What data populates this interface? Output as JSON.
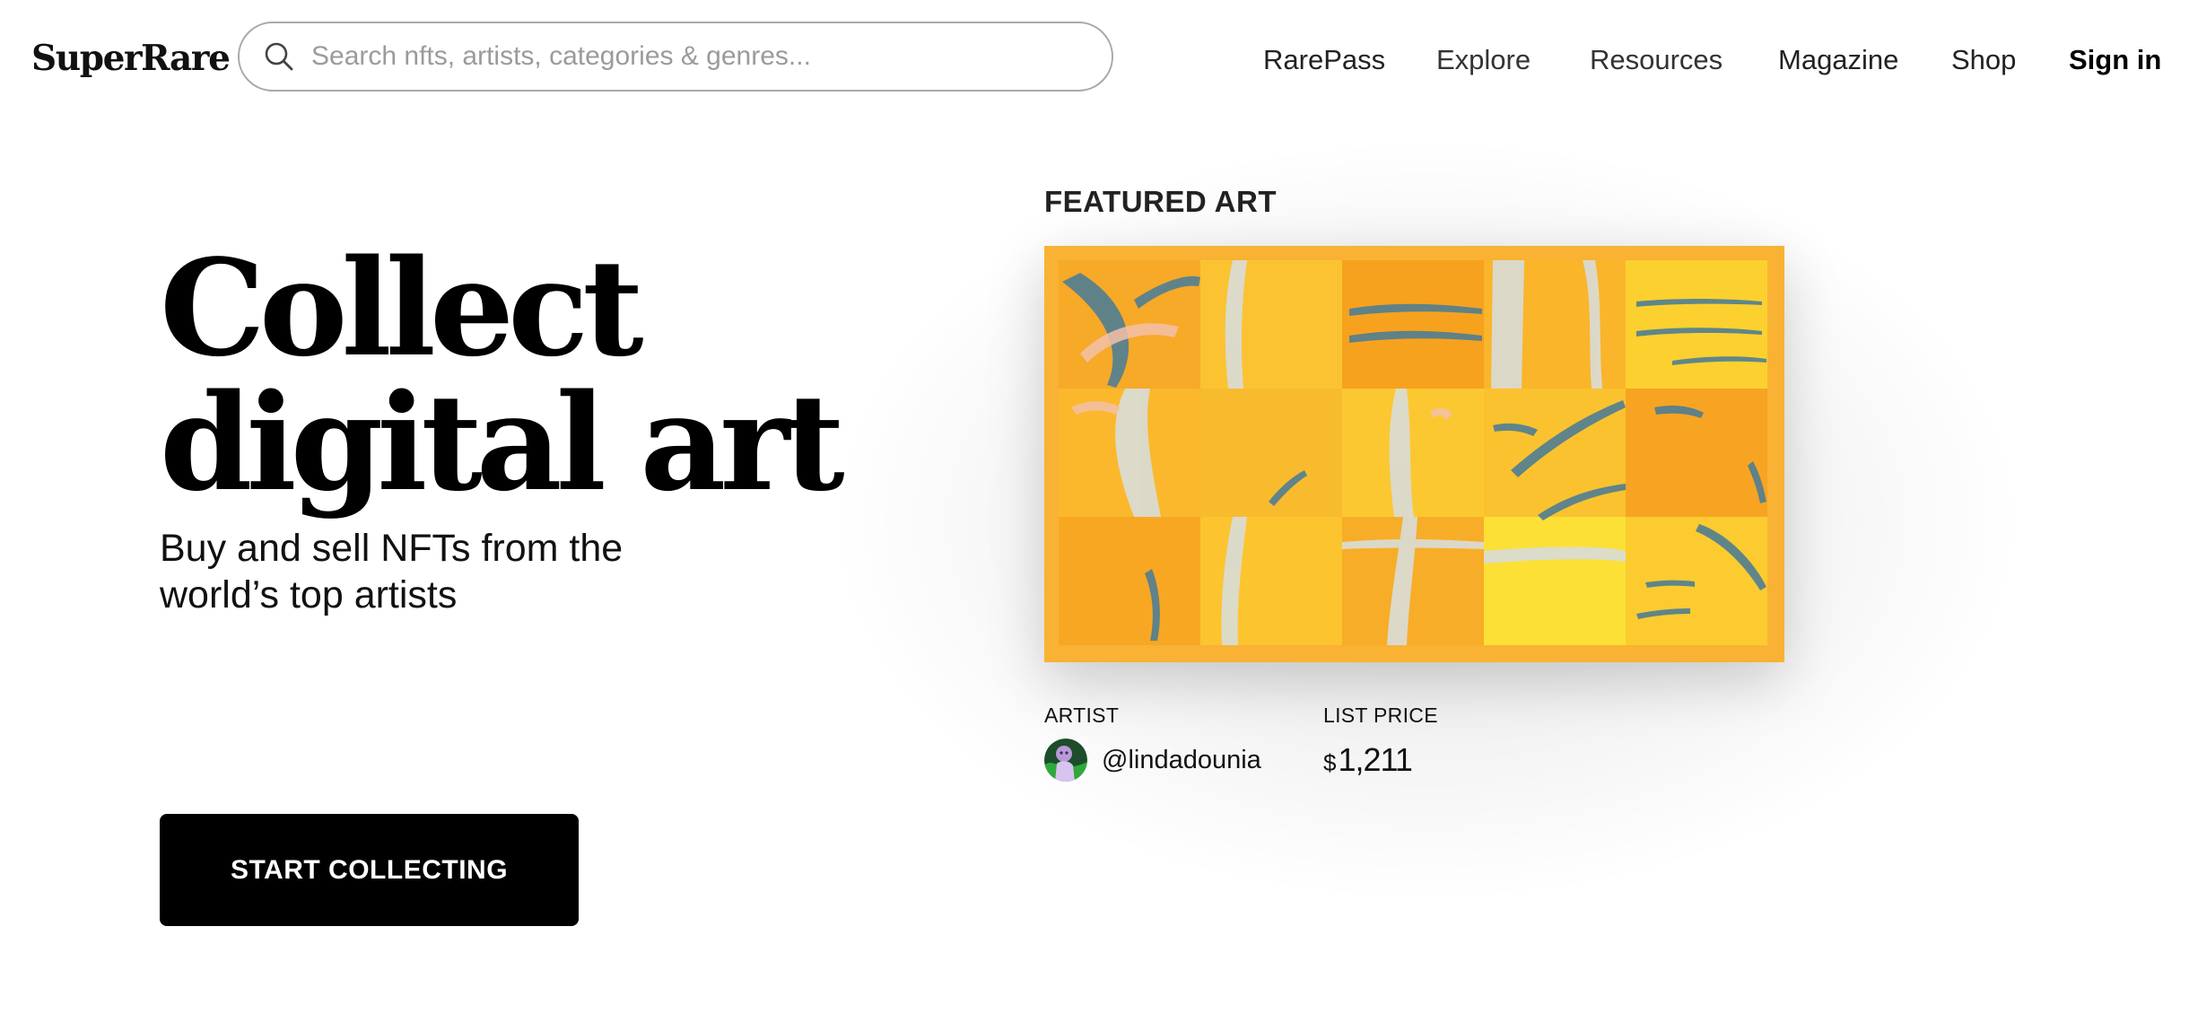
{
  "header": {
    "logo": "SuperRare",
    "search_placeholder": "Search nfts, artists, categories & genres...",
    "nav": [
      "RarePass",
      "Explore",
      "Resources",
      "Magazine",
      "Shop"
    ],
    "sign_in": "Sign in"
  },
  "hero": {
    "title_line1": "Collect",
    "title_line2": "digital art",
    "subtitle": "Buy and sell NFTs from the world’s top artists",
    "cta_label": "START COLLECTING"
  },
  "featured": {
    "label": "FEATURED ART",
    "artist_label": "ARTIST",
    "artist_handle": "@lindadounia",
    "price_label": "LIST PRICE",
    "price_currency": "$",
    "price_amount": "1,211"
  },
  "icons": {
    "search": "search-icon",
    "avatar": "artist-avatar"
  },
  "colors": {
    "artwork_base": "#f9b233",
    "cta_background": "#000000",
    "search_border": "#a9a9a9"
  }
}
